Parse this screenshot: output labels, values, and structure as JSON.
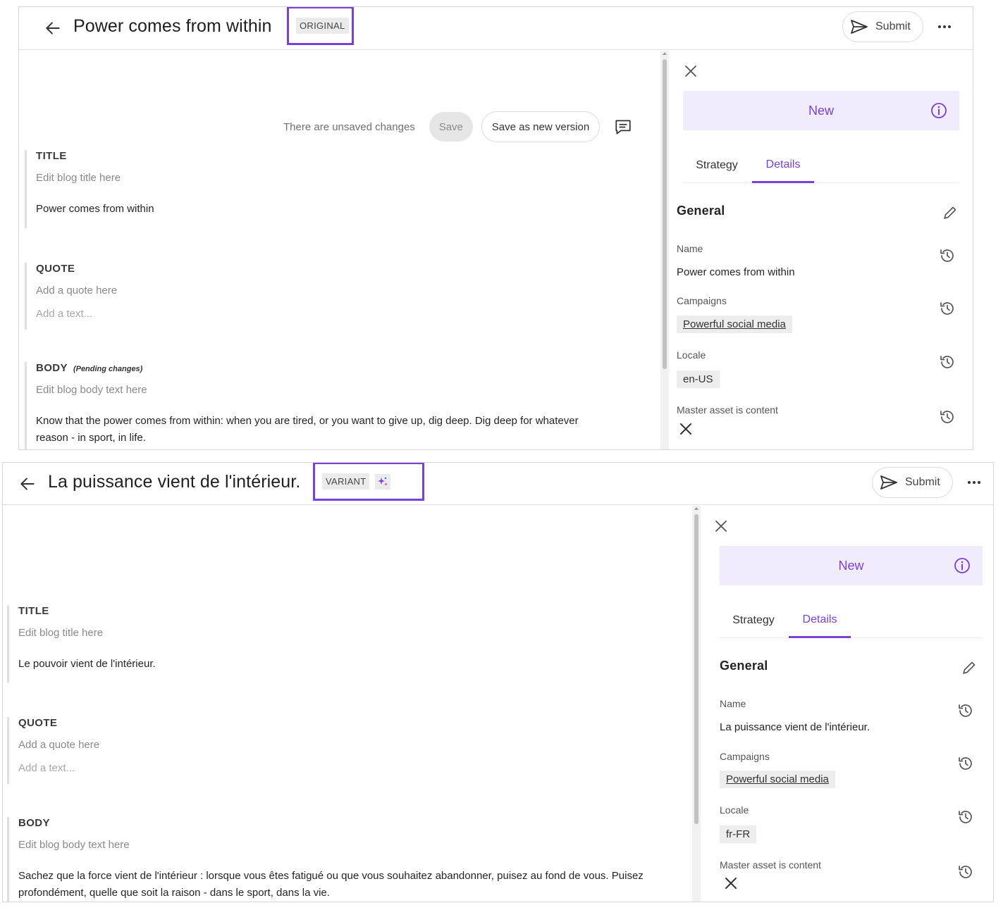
{
  "original": {
    "title": "Power comes from within",
    "badge": "ORIGINAL",
    "submit_label": "Submit",
    "toolbar": {
      "unsaved_text": "There are unsaved changes",
      "save_label": "Save",
      "save_new_label": "Save as new version"
    },
    "fields": {
      "title": {
        "label": "TITLE",
        "hint": "Edit blog title here",
        "value": "Power comes from within"
      },
      "quote": {
        "label": "QUOTE",
        "hint": "Add a quote here",
        "placeholder": "Add a text..."
      },
      "body": {
        "label": "BODY",
        "pending": "(Pending changes)",
        "hint": "Edit blog body text here",
        "value": "Know that the power comes from within: when you are tired, or you want to give up, dig deep. Dig deep for whatever reason - in sport, in life."
      }
    },
    "panel": {
      "status": "New",
      "tabs": [
        "Strategy",
        "Details"
      ],
      "section": "General",
      "name_label": "Name",
      "name_value": "Power comes from within",
      "campaigns_label": "Campaigns",
      "campaign": "Powerful social media",
      "locale_label": "Locale",
      "locale": "en-US",
      "master_label": "Master asset is content"
    }
  },
  "variant": {
    "title": "La puissance vient de l'intérieur.",
    "badge": "VARIANT",
    "submit_label": "Submit",
    "fields": {
      "title": {
        "label": "TITLE",
        "hint": "Edit blog title here",
        "value": "Le pouvoir vient de l'intérieur."
      },
      "quote": {
        "label": "QUOTE",
        "hint": "Add a quote here",
        "placeholder": "Add a text..."
      },
      "body": {
        "label": "BODY",
        "hint": "Edit blog body text here",
        "value": "Sachez que la force vient de l'intérieur : lorsque vous êtes fatigué ou que vous souhaitez abandonner, puisez au fond de vous. Puisez profondément, quelle que soit la raison - dans le sport, dans la vie."
      }
    },
    "panel": {
      "status": "New",
      "tabs": [
        "Strategy",
        "Details"
      ],
      "section": "General",
      "name_label": "Name",
      "name_value": "La puissance vient de l'intérieur.",
      "campaigns_label": "Campaigns",
      "campaign": "Powerful social media",
      "locale_label": "Locale",
      "locale": "fr-FR",
      "master_label": "Master asset is content"
    }
  },
  "colors": {
    "accent": "#7b40d6",
    "banner": "#f0ebfd",
    "chip": "#ededed"
  },
  "icons": [
    "back-arrow-icon",
    "send-icon",
    "more-icon",
    "comment-icon",
    "close-icon",
    "info-icon",
    "pencil-icon",
    "history-icon",
    "sparkle-icon"
  ]
}
